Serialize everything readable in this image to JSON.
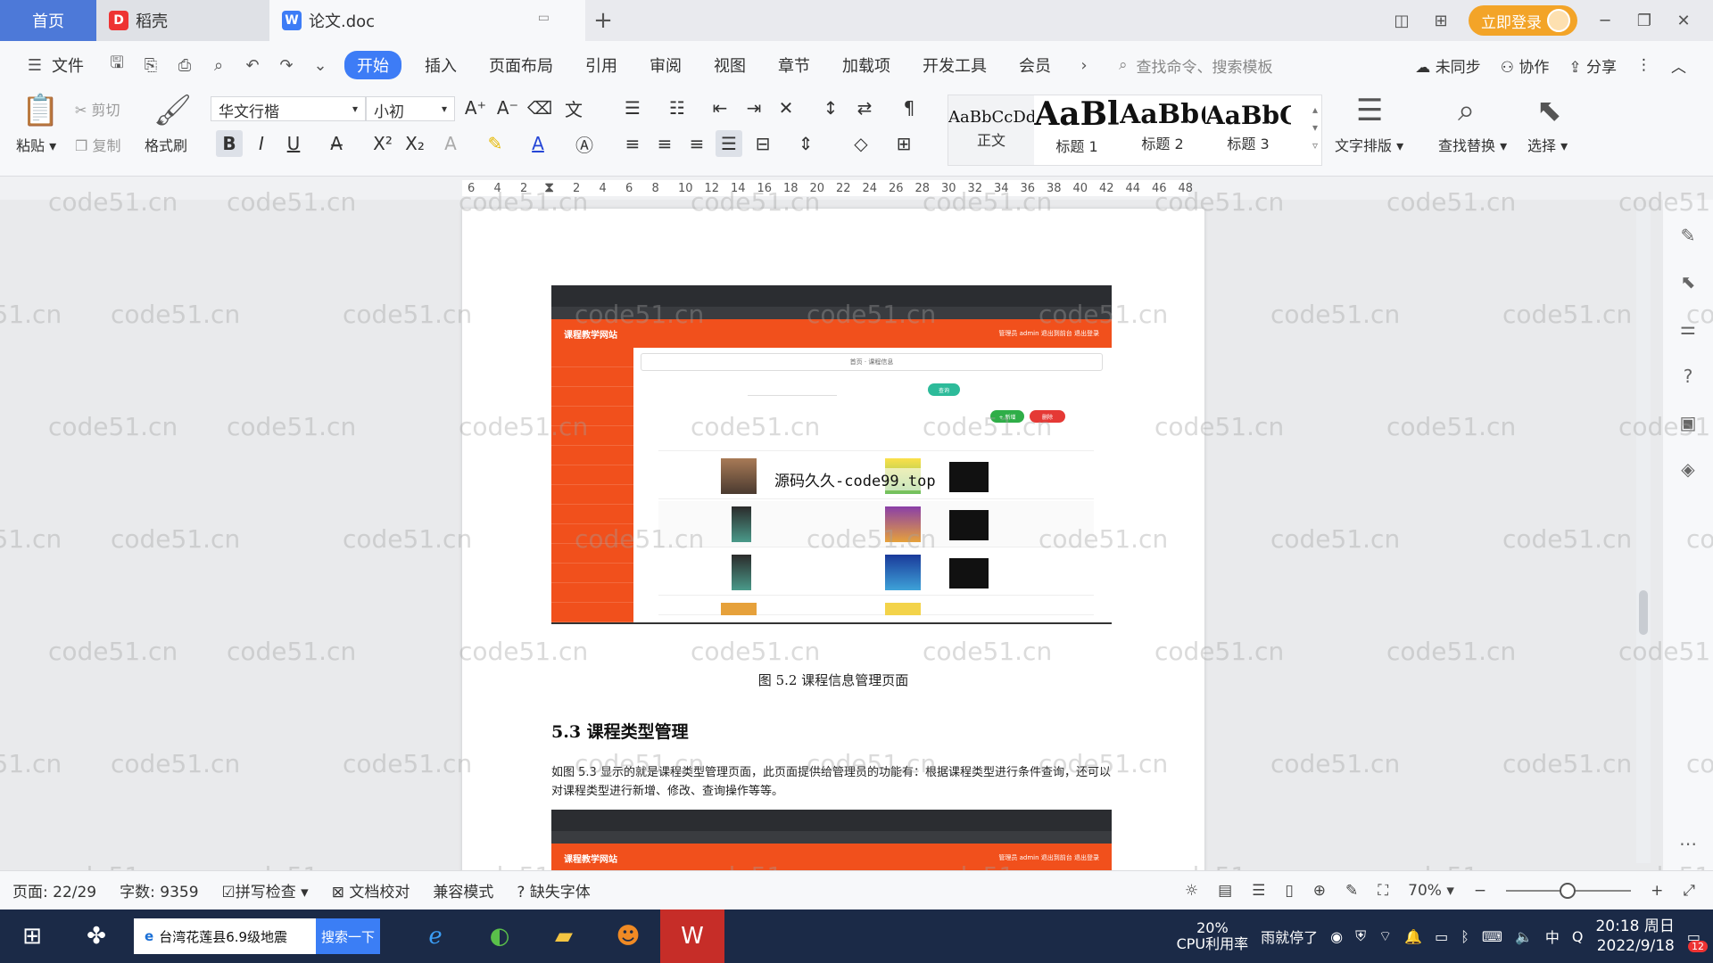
{
  "titlebar": {
    "home_tab": "首页",
    "daoke_tab": "稻壳",
    "doc_tab": "论文.doc",
    "login": "立即登录"
  },
  "menu": {
    "file": "文件",
    "items": [
      "开始",
      "插入",
      "页面布局",
      "引用",
      "审阅",
      "视图",
      "章节",
      "加载项",
      "开发工具",
      "会员"
    ],
    "search_cmd": "查找命令、搜索模板",
    "unsync": "未同步",
    "collab": "协作",
    "share": "分享"
  },
  "ribbon": {
    "paste": "粘贴",
    "cut": "剪切",
    "copy": "复制",
    "format_painter": "格式刷",
    "font_name": "华文行楷",
    "font_size": "小初",
    "styles": [
      {
        "sample": "AaBbCcDd",
        "label": "正文"
      },
      {
        "sample": "AaBl",
        "label": "标题 1"
      },
      {
        "sample": "AaBb(",
        "label": "标题 2"
      },
      {
        "sample": "AaBbC",
        "label": "标题 3"
      }
    ],
    "text_layout": "文字排版",
    "find_replace": "查找替换",
    "select": "选择"
  },
  "ruler": {
    "numbers": [
      "6",
      "4",
      "2",
      "",
      "2",
      "4",
      "6",
      "8",
      "10",
      "12",
      "14",
      "16",
      "18",
      "20",
      "22",
      "24",
      "26",
      "28",
      "30",
      "32",
      "34",
      "36",
      "38",
      "40",
      "42",
      "44",
      "46",
      "48"
    ]
  },
  "document": {
    "figure1": {
      "site_title": "课程教学网站",
      "header_right": "管理员 admin   退出到前台   退出登录",
      "crumb": "首页 · 课程信息",
      "btn_search": "查询",
      "btn_add": "+ 新增",
      "btn_delete": "删除"
    },
    "source_watermark": "源码久久-code99.top",
    "caption": "图 5.2  课程信息管理页面",
    "heading": "5.3 课程类型管理",
    "paragraph": "如图 5.3 显示的就是课程类型管理页面，此页面提供给管理员的功能有：根据课程类型进行条件查询，还可以对课程类型进行新增、修改、查询操作等等。",
    "figure2": {
      "site_title": "课程教学网站",
      "header_right": "管理员 admin   退出到前台   退出登录"
    }
  },
  "watermark_text": "code51.cn",
  "statusbar": {
    "page": "页面: 22/29",
    "words": "字数: 9359",
    "spell": "拼写检查",
    "doc_check": "文档校对",
    "compat": "兼容模式",
    "missing_font": "缺失字体",
    "zoom": "70%"
  },
  "taskbar": {
    "news": "台湾花莲县6.9级地震",
    "search_btn": "搜索一下",
    "cpu_pct": "20%",
    "cpu_label": "CPU利用率",
    "rain": "雨就停了",
    "ime": "中",
    "time": "20:18 周日",
    "date": "2022/9/18",
    "notif": "12"
  },
  "colors": {
    "accent": "#3d7cf6",
    "home_tab": "#4d79d8",
    "login": "#f3a428",
    "site_orange": "#f1501c",
    "taskbar": "#1b2a47"
  }
}
